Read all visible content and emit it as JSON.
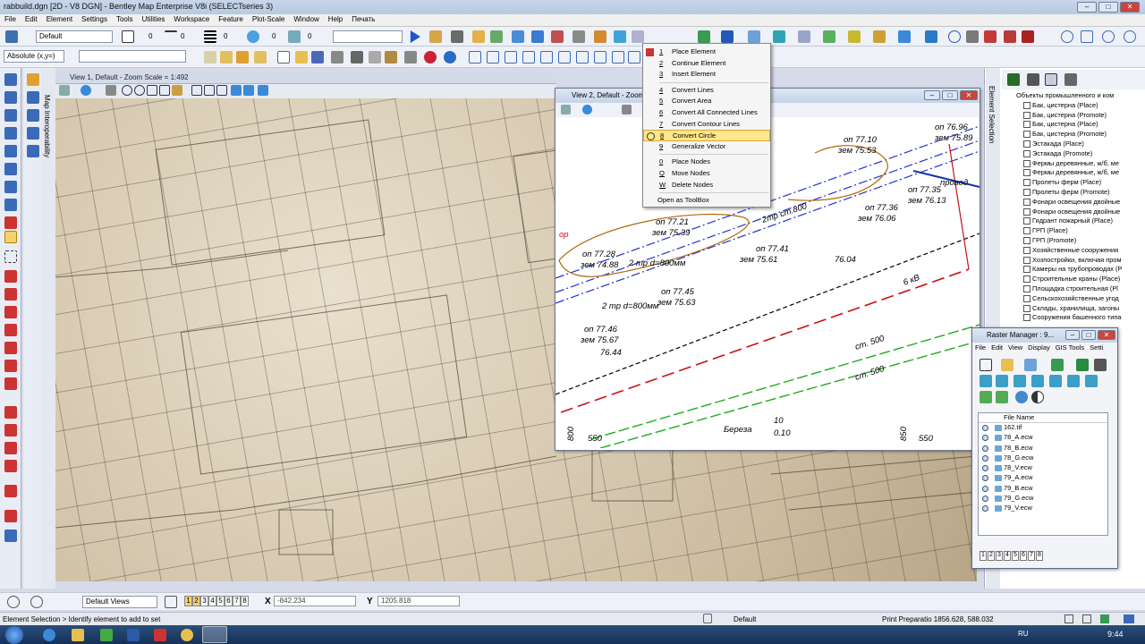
{
  "app": {
    "title": "rabbuild.dgn [2D - V8 DGN] - Bentley Map Enterprise V8i (SELECTseries 3)"
  },
  "menu": [
    "File",
    "Edit",
    "Element",
    "Settings",
    "Tools",
    "Utilities",
    "Workspace",
    "Feature",
    "Plot-Scale",
    "Window",
    "Help",
    "Печать"
  ],
  "toolbar": {
    "level": "Default",
    "color_index": "0",
    "style_index": "0",
    "weight_index": "0",
    "transparency_index": "0",
    "priority_index": "0",
    "accudraw_mode": "Absolute (x,y=)"
  },
  "left_panel": {
    "map_interoperability": "Map Interoperability"
  },
  "view1": {
    "title": "View 1, Default - Zoom Scale = 1:492"
  },
  "view2": {
    "title": "View 2, Default - Zoom",
    "labels": {
      "l1": "оп 77.10",
      "l2": "зем 75.53",
      "l3": "оп 76.96",
      "l4": "зем 75.89",
      "l5": "2тр ст.800",
      "l6": "оп 77.36",
      "l7": "зем 76.06",
      "l8": "оп 77.35",
      "l9": "зем 76.13",
      "l10": "оп 77.21",
      "l11": "зем 75.39",
      "l12": "оп 77.28",
      "l13": "зем 74.88",
      "l14": "2 тр d=800мм",
      "l15": "оп 77.41",
      "l16": "зем 75.61",
      "l17": "76.04",
      "l18": "оп 77.45",
      "l19": "зем 75.63",
      "l20": "2 тр d=800мм",
      "l21": "6 кВ",
      "l22": "оп 77.46",
      "l23": "зем 75.67",
      "l24": "76.44",
      "l25": "ст. 500",
      "l26": "ст. 500",
      "l27": "Береза",
      "l28": "10",
      "l29": "0.10",
      "l30": "550",
      "l31": "800",
      "l32": "850",
      "l33": "550",
      "l34": "ор",
      "l35": "провод"
    }
  },
  "popup_menu": {
    "items": [
      {
        "key": "1",
        "label": "Place Element"
      },
      {
        "key": "2",
        "label": "Continue Element"
      },
      {
        "key": "3",
        "label": "Insert Element"
      },
      {
        "key": "4",
        "label": "Convert Lines"
      },
      {
        "key": "5",
        "label": "Convert Area"
      },
      {
        "key": "6",
        "label": "Convert All Connected Lines"
      },
      {
        "key": "7",
        "label": "Convert Contour Lines"
      },
      {
        "key": "8",
        "label": "Convert Circle"
      },
      {
        "key": "9",
        "label": "Generalize Vector"
      },
      {
        "key": "0",
        "label": "Place Nodes"
      },
      {
        "key": "Q",
        "label": "Move Nodes"
      },
      {
        "key": "W",
        "label": "Delete Nodes"
      }
    ],
    "toolbox": "Open as ToolBox",
    "selected_index": 7
  },
  "element_panel": {
    "side_label": "Element Selection",
    "root": "Объекты промышленного и ком",
    "items": [
      "Бак, цистерна (Place)",
      "Бак, цистерна (Promote)",
      "Бак, цистерна (Place)",
      "Бак, цистерна (Promote)",
      "Эстакада (Place)",
      "Эстакада (Promote)",
      "Фермы деревянные, ж/б, ме",
      "Фермы деревянные, ж/б, ме",
      "Пролеты ферм (Place)",
      "Пролеты ферм (Promote)",
      "Фонари освещения двойные",
      "Фонари освещения двойные",
      "Гидрант пожарный (Place)",
      "ГРП (Place)",
      "ГРП (Promote)",
      "Хозяйственные сооружения",
      "Хозпостройки, включая пром",
      "Камеры на трубопроводах (P",
      "Строительные краны (Place)",
      "Площадка строительная (Pl",
      "Сельскохозяйственные угод",
      "Склады, хранилища, загоны",
      "Сооружения башенного типа"
    ]
  },
  "raster_manager": {
    "title": "Raster Manager : 9...",
    "menu": [
      "File",
      "Edit",
      "View",
      "Display",
      "GIS Tools",
      "Setti"
    ],
    "column": "File Name",
    "files": [
      "162.tif",
      "78_A.ecw",
      "78_B.ecw",
      "78_G.ecw",
      "78_V.ecw",
      "79_A.ecw",
      "79_B.ecw",
      "79_G.ecw",
      "79_V.ecw"
    ],
    "pages": [
      "1",
      "2",
      "3",
      "4",
      "5",
      "6",
      "7",
      "8"
    ]
  },
  "viewbar": {
    "views": "Default Views",
    "pages": [
      "1",
      "2",
      "3",
      "4",
      "5",
      "6",
      "7",
      "8"
    ],
    "x_label": "X",
    "x_value": "-842.234",
    "y_label": "Y",
    "y_value": "1205.818"
  },
  "status": {
    "prompt": "Element Selection > Identify element to add to set",
    "level": "Default",
    "coords": "Print Preparatio 1856.628, 588.032"
  },
  "taskbar": {
    "lang": "RU",
    "time": "9:44"
  }
}
